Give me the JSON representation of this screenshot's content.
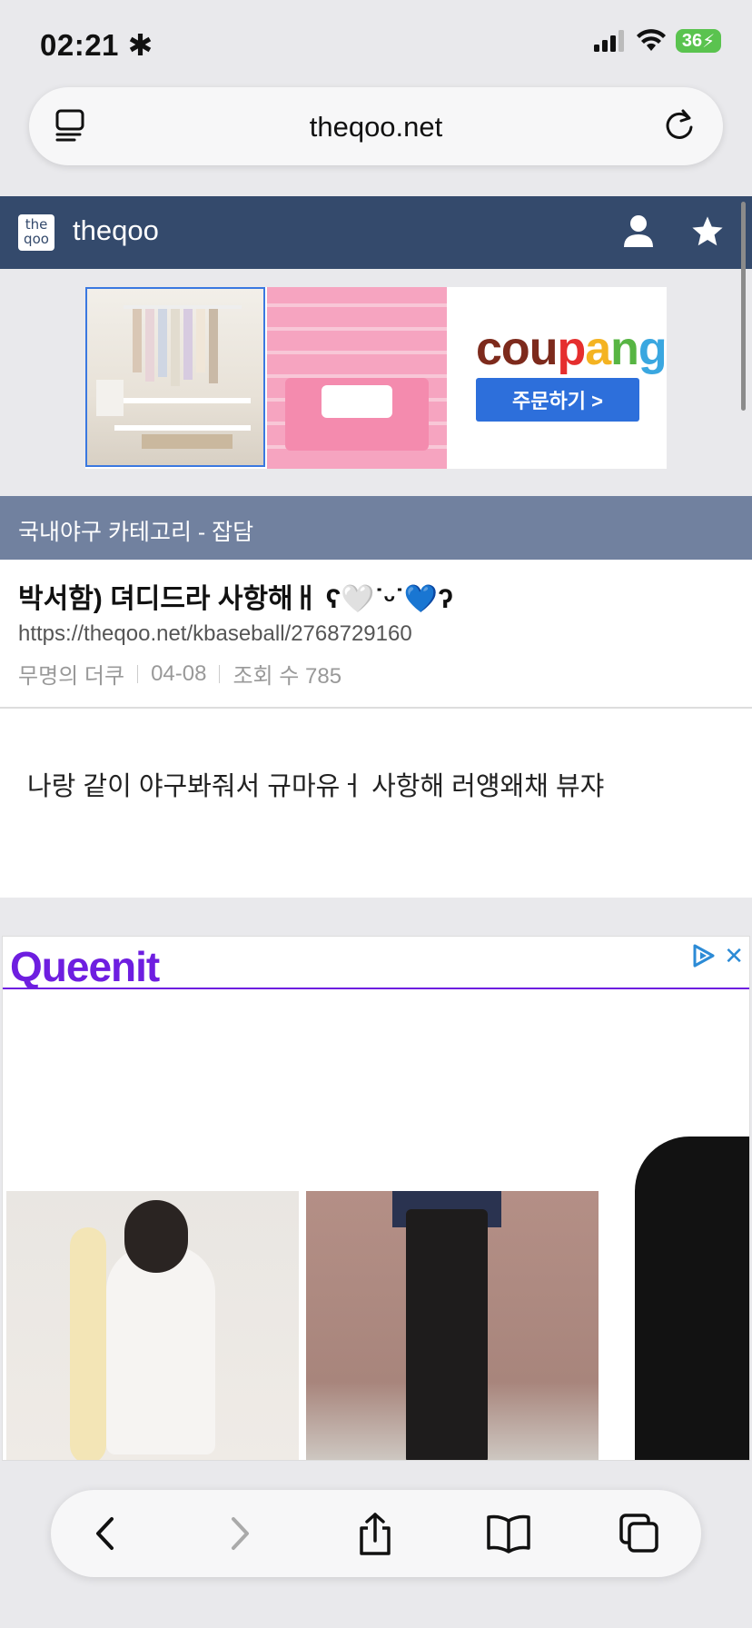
{
  "status_bar": {
    "time": "02:21 ✱",
    "battery": "36"
  },
  "address_bar": {
    "url": "theqoo.net"
  },
  "site_header": {
    "logo_text": "the\nqoo",
    "site_name": "theqoo"
  },
  "ad_banner": {
    "brand": [
      "c",
      "o",
      "u",
      "p",
      "a",
      "n",
      "g"
    ],
    "brand_colors": [
      "#7d2a1c",
      "#7d2a1c",
      "#7d2a1c",
      "#e52e2e",
      "#f4b321",
      "#57b543",
      "#3aa7e0"
    ],
    "order_button": "주문하기 >"
  },
  "category": {
    "label": "국내야구 카테고리 - 잡담"
  },
  "post": {
    "title": "박서함) 뎌디드라 사항해ㅐ ʕ🤍˙ᵕ˙💙ʔ",
    "url": "https://theqoo.net/kbaseball/2768729160",
    "author": "무명의 더쿠",
    "date": "04-08",
    "views": "조회 수 785",
    "body": "나랑 같이 야구봐줘서 규마유ㅓ  사항해 러얭왜채 뷰쟈"
  },
  "queenit_ad": {
    "brand": "Queenit",
    "close": "✕"
  },
  "colors": {
    "header_bg": "#344a6c",
    "category_bg": "#71819f",
    "queenit_purple": "#6e1ee0",
    "coupang_btn": "#2d6fdb"
  }
}
